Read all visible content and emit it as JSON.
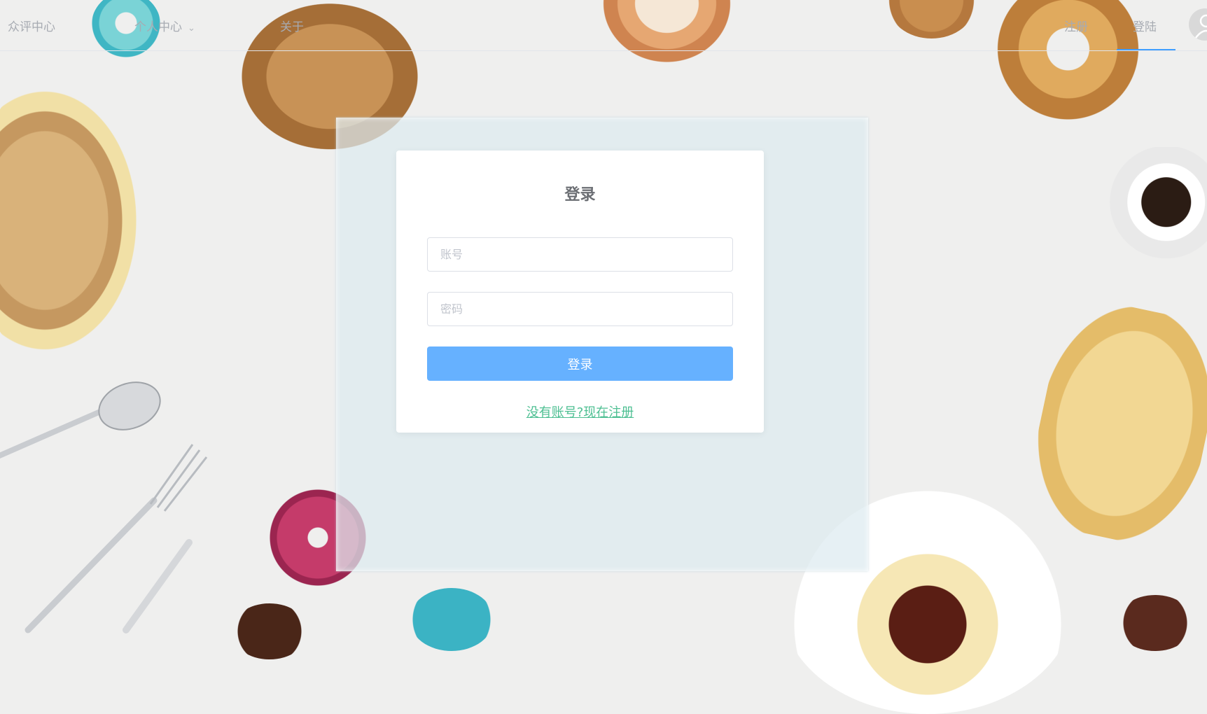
{
  "nav": {
    "home": "众评中心",
    "personal_center": "个人中心",
    "about": "关于",
    "register": "注册",
    "login": "登陆"
  },
  "login_card": {
    "title": "登录",
    "account_placeholder": "账号",
    "password_placeholder": "密码",
    "submit_label": "登录",
    "register_link": "没有账号?现在注册"
  },
  "colors": {
    "primary_button": "#66b1ff",
    "link": "#4dbf92",
    "active_underline": "#409eff"
  }
}
